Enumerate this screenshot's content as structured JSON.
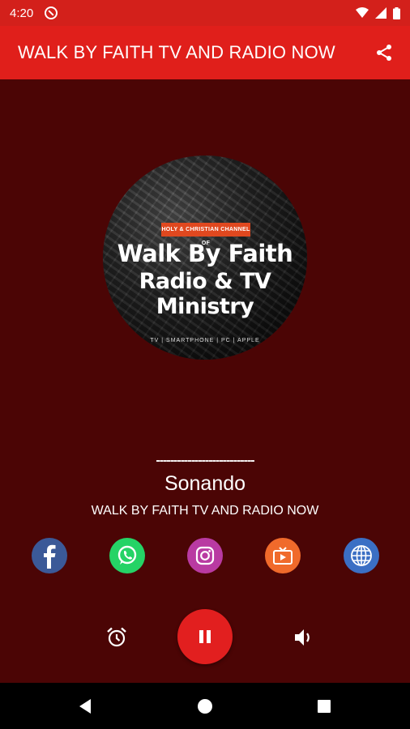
{
  "status_bar": {
    "time": "4:20"
  },
  "app_bar": {
    "title": "WALK BY FAITH TV AND RADIO NOW"
  },
  "logo": {
    "banner": "HOLY & CHRISTIAN CHANNEL OF",
    "line1": "Walk By Faith",
    "line2": "Radio & TV Ministry",
    "footer": "TV | SMARTPHONE | PC | APPLE"
  },
  "player": {
    "metadata": "----------------------------",
    "status": "Sonando",
    "station": "WALK BY FAITH TV AND RADIO NOW"
  },
  "social": [
    {
      "icon": "facebook-icon",
      "color": "#3b5998"
    },
    {
      "icon": "whatsapp-icon",
      "color": "#25d366"
    },
    {
      "icon": "instagram-icon",
      "color": "#b93aa2"
    },
    {
      "icon": "tv-icon",
      "color": "#f06a2b"
    },
    {
      "icon": "globe-icon",
      "color": "#3b6fc4"
    }
  ],
  "colors": {
    "app_bar": "#e01f1b",
    "status_bar": "#d3201b",
    "background": "#4b0505",
    "play_button": "#e21f1f"
  }
}
